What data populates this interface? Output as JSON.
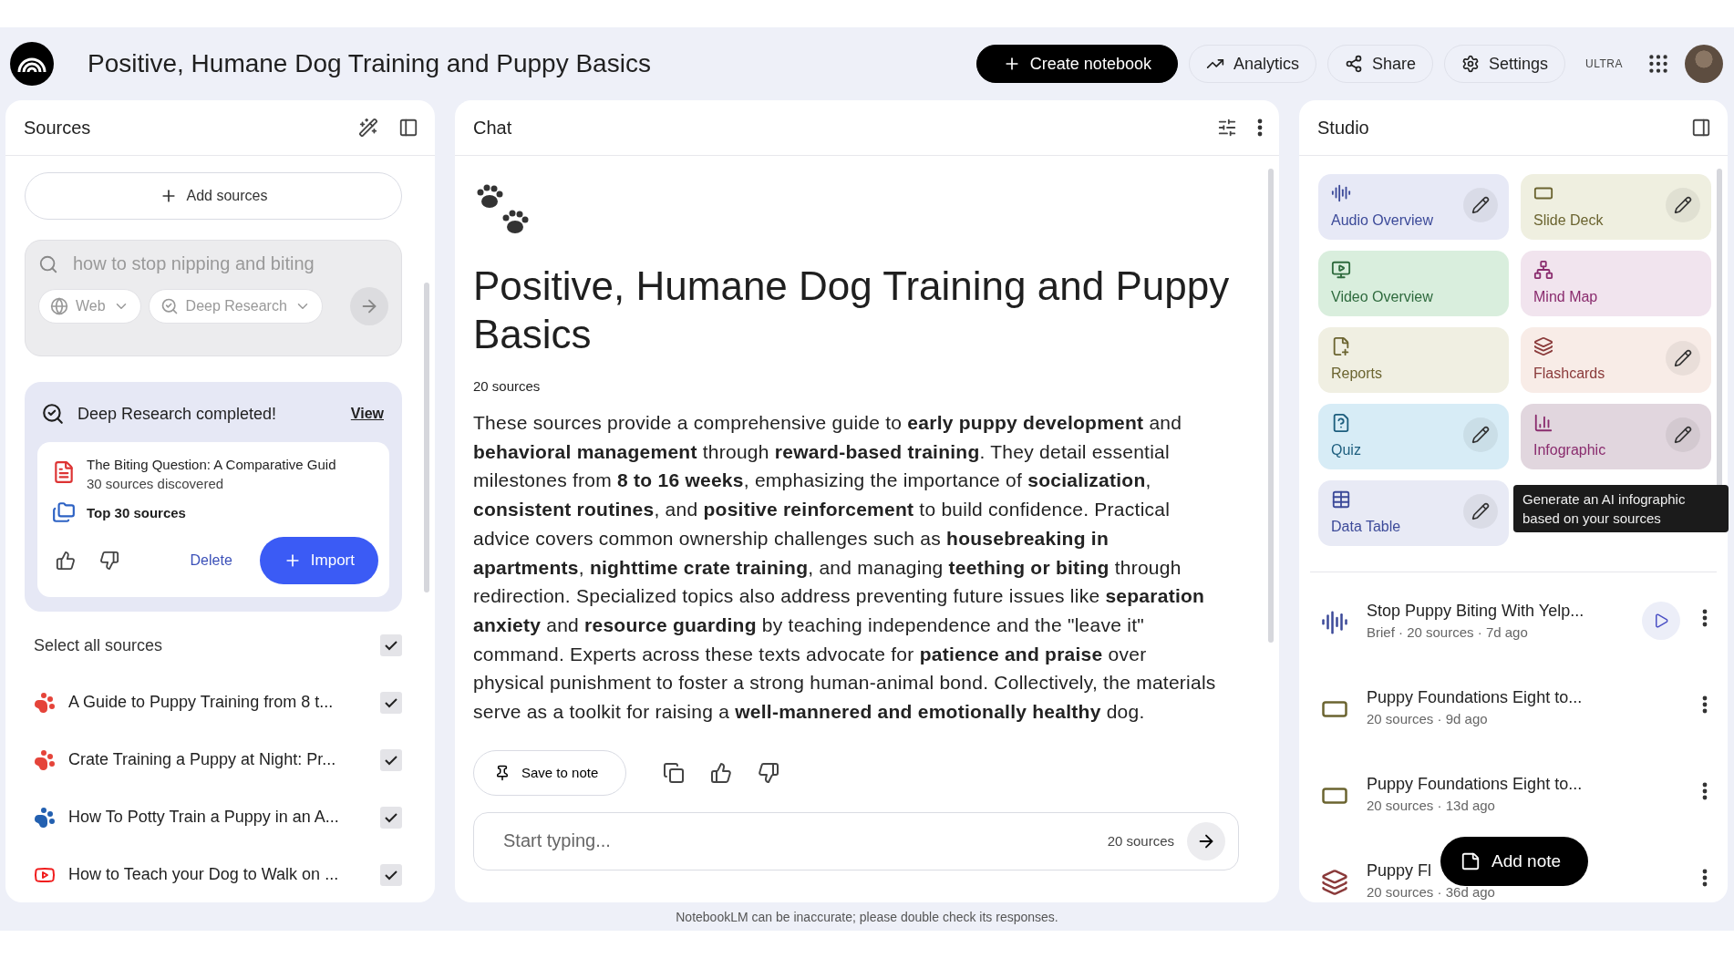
{
  "header": {
    "title": "Positive, Humane Dog Training and Puppy Basics",
    "create_button": "Create notebook",
    "analytics_button": "Analytics",
    "share_button": "Share",
    "settings_button": "Settings",
    "plan_badge": "ULTRA"
  },
  "sources": {
    "title": "Sources",
    "add_button": "Add sources",
    "search": {
      "value": "how to stop nipping and biting",
      "web_dropdown": "Web",
      "mode_dropdown": "Deep Research"
    },
    "research_card": {
      "title": "Deep Research completed!",
      "view_link": "View",
      "result_title": "The Biting Question: A Comparative Guid",
      "result_meta": "30 sources discovered",
      "top_sources": "Top 30 sources",
      "delete_button": "Delete",
      "import_button": "Import"
    },
    "select_all": {
      "label": "Select all sources",
      "checked": true
    },
    "items": [
      {
        "title": "A Guide to Puppy Training from 8 t...",
        "kind": "paw",
        "color": "#e5443a",
        "checked": true
      },
      {
        "title": "Crate Training a Puppy at Night: Pr...",
        "kind": "paw",
        "color": "#e5443a",
        "checked": true
      },
      {
        "title": "How To Potty Train a Puppy in an A...",
        "kind": "paw",
        "color": "#2360b0",
        "checked": true
      },
      {
        "title": "How to Teach your Dog to Walk on ...",
        "kind": "video",
        "color": "#f01d1d",
        "checked": true
      }
    ]
  },
  "chat": {
    "title": "Chat",
    "notebook_title": "Positive, Humane Dog Training and Puppy Basics",
    "source_count": "20 sources",
    "summary": "These sources provide a comprehensive guide to **early puppy development** and **behavioral management** through **reward-based training**. They detail essential milestones from **8 to 16 weeks**, emphasizing the importance of **socialization**, **consistent routines**, and **positive reinforcement** to build confidence. Practical advice covers common ownership challenges such as **housebreaking in apartments**, **nighttime crate training**, and managing **teething or biting** through redirection. Specialized topics also address preventing future issues like **separation anxiety** and **resource guarding** by teaching independence and the \"leave it\" command. Experts across these texts advocate for **patience and praise** over physical punishment to foster a strong human-animal bond. Collectively, the materials serve as a toolkit for raising a **well-mannered and emotionally healthy** dog.",
    "save_button": "Save to note",
    "input": {
      "placeholder": "Start typing...",
      "source_count": "20 sources"
    }
  },
  "studio": {
    "title": "Studio",
    "tiles": [
      {
        "label": "Audio Overview",
        "kind": "audio",
        "color": "#e7e9f6",
        "editable": true
      },
      {
        "label": "Slide Deck",
        "kind": "slides",
        "color": "#efefe0",
        "editable": true
      },
      {
        "label": "Video Overview",
        "kind": "video",
        "color": "#d9eedd",
        "editable": false
      },
      {
        "label": "Mind Map",
        "kind": "mindmap",
        "color": "#f1e4ee",
        "editable": false
      },
      {
        "label": "Reports",
        "kind": "reports",
        "color": "#f0efe2",
        "editable": false
      },
      {
        "label": "Flashcards",
        "kind": "flashcards",
        "color": "#f8ece7",
        "editable": true
      },
      {
        "label": "Quiz",
        "kind": "quiz",
        "color": "#d7ecf6",
        "editable": true
      },
      {
        "label": "Infographic",
        "kind": "infographic",
        "color": "#e1d6de",
        "editable": true
      },
      {
        "label": "Data Table",
        "kind": "table",
        "color": "#e8eaf5",
        "editable": true
      }
    ],
    "tooltip": "Generate an AI infographic based on your sources",
    "notes": [
      {
        "title": "Stop Puppy Biting With Yelp...",
        "meta": "Brief · 20 sources · 7d ago",
        "kind": "audio",
        "playable": true
      },
      {
        "title": "Puppy Foundations Eight to...",
        "meta": "20 sources · 9d ago",
        "kind": "slides",
        "playable": false
      },
      {
        "title": "Puppy Foundations Eight to...",
        "meta": "20 sources · 13d ago",
        "kind": "slides",
        "playable": false
      },
      {
        "title": "Puppy Fl",
        "meta": "20 sources · 36d ago",
        "kind": "flashcards",
        "playable": false
      }
    ],
    "add_note_button": "Add note"
  },
  "footer": "NotebookLM can be inaccurate; please double check its responses."
}
